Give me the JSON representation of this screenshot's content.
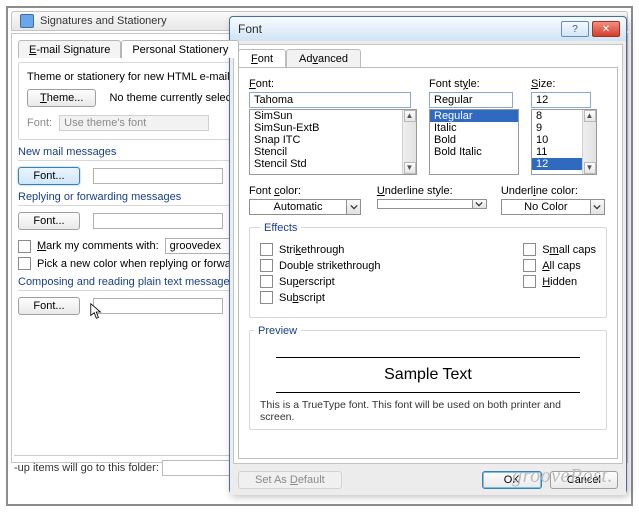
{
  "sig": {
    "title": "Signatures and Stationery",
    "tabs": {
      "email": "E-mail Signature",
      "personal": "Personal Stationery"
    },
    "theme_line": "Theme or stationery for new HTML e-mail message",
    "theme_btn": "Theme...",
    "no_theme": "No theme currently selected",
    "font_lbl": "Font:",
    "font_val": "Use theme's font",
    "new_mail": "New mail messages",
    "font_btn": "Font...",
    "reply_fwd": "Replying or forwarding messages",
    "mark_comments": "Mark my comments with:",
    "mark_val": "groovedex",
    "pick_color": "Pick a new color when replying or forwarding",
    "plain_text": "Composing and reading plain text messages",
    "followup": "-up items will go to this folder:"
  },
  "font": {
    "title": "Font",
    "help_tip": "?",
    "close_tip": "✕",
    "tabs": {
      "font": "Font",
      "advanced": "Advanced"
    },
    "font_lbl": "Font:",
    "font_val": "Tahoma",
    "font_list": [
      "SimSun",
      "SimSun-ExtB",
      "Snap ITC",
      "Stencil",
      "Stencil Std"
    ],
    "style_lbl": "Font style:",
    "style_val": "Regular",
    "style_list": [
      "Regular",
      "Italic",
      "Bold",
      "Bold Italic"
    ],
    "size_lbl": "Size:",
    "size_val": "12",
    "size_list": [
      "8",
      "9",
      "10",
      "11",
      "12"
    ],
    "color_lbl": "Font color:",
    "color_val": "Automatic",
    "ustyle_lbl": "Underline style:",
    "ustyle_val": "",
    "ucolor_lbl": "Underline color:",
    "ucolor_val": "No Color",
    "effects_lbl": "Effects",
    "fx": {
      "strike": "Strikethrough",
      "dstrike": "Double strikethrough",
      "super": "Superscript",
      "sub": "Subscript",
      "small": "Small caps",
      "all": "All caps",
      "hidden": "Hidden"
    },
    "preview_lbl": "Preview",
    "preview_text": "Sample Text",
    "preview_note": "This is a TrueType font. This font will be used on both printer and screen.",
    "set_default": "Set As Default",
    "ok": "OK",
    "cancel": "Cancel"
  },
  "watermark": "groovePost."
}
